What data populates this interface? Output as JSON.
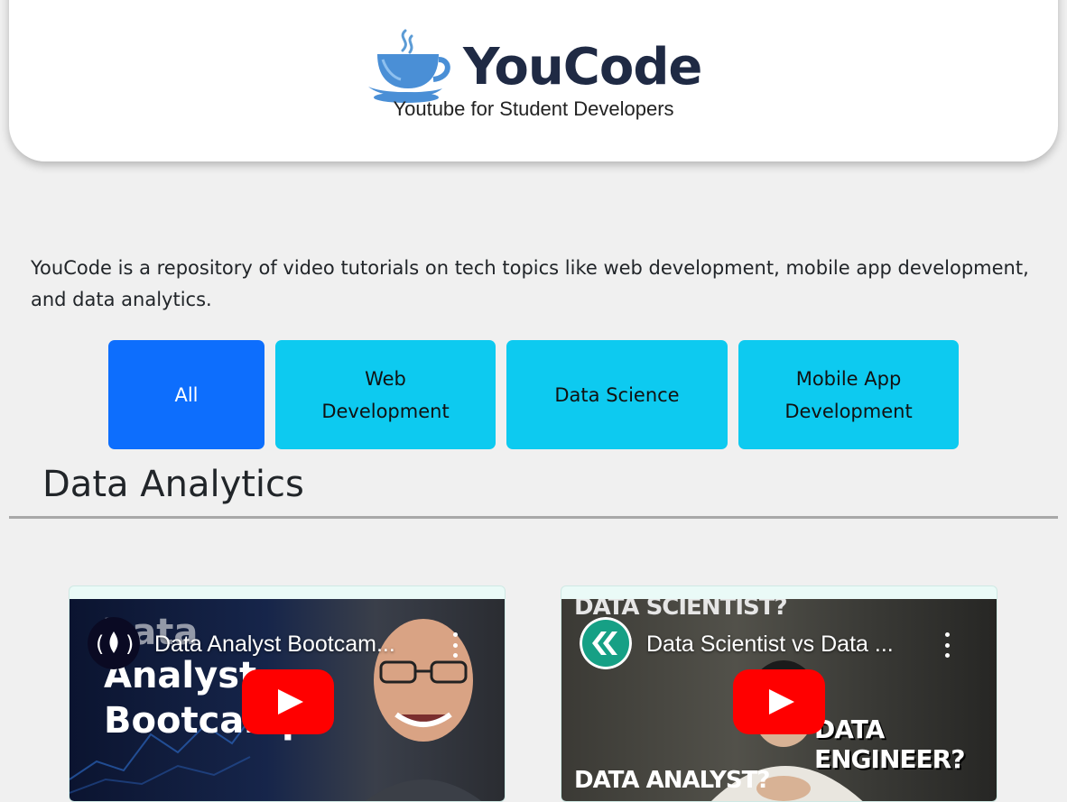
{
  "header": {
    "brand": "YouCode",
    "tagline": "Youtube for Student Developers"
  },
  "intro": "YouCode is a repository of video tutorials on tech topics like web development, mobile app development, and data analytics.",
  "filters": [
    {
      "label": "All",
      "active": true
    },
    {
      "label": "Web Development",
      "active": false
    },
    {
      "label": "Data Science",
      "active": false
    },
    {
      "label": "Mobile App Development",
      "active": false
    }
  ],
  "section": {
    "title": "Data Analytics"
  },
  "videos": [
    {
      "title": "Data Analyst Bootcam...",
      "thumb_text": [
        "Data",
        "Analyst",
        "Bootcamp"
      ]
    },
    {
      "title": "Data Scientist vs Data ...",
      "thumb_text": [
        "DATA SCIENTIST?",
        "DATA ENGINEER?",
        "DATA ANALYST?"
      ]
    }
  ],
  "colors": {
    "accent": "#0d6efd",
    "filter_secondary": "#0dcaf0",
    "youtube_red": "#ff0000",
    "brand_text": "#1f2a44"
  },
  "icons": {
    "logo": "coffee-cup-icon",
    "play": "youtube-play-icon",
    "menu": "kebab-menu-icon"
  }
}
